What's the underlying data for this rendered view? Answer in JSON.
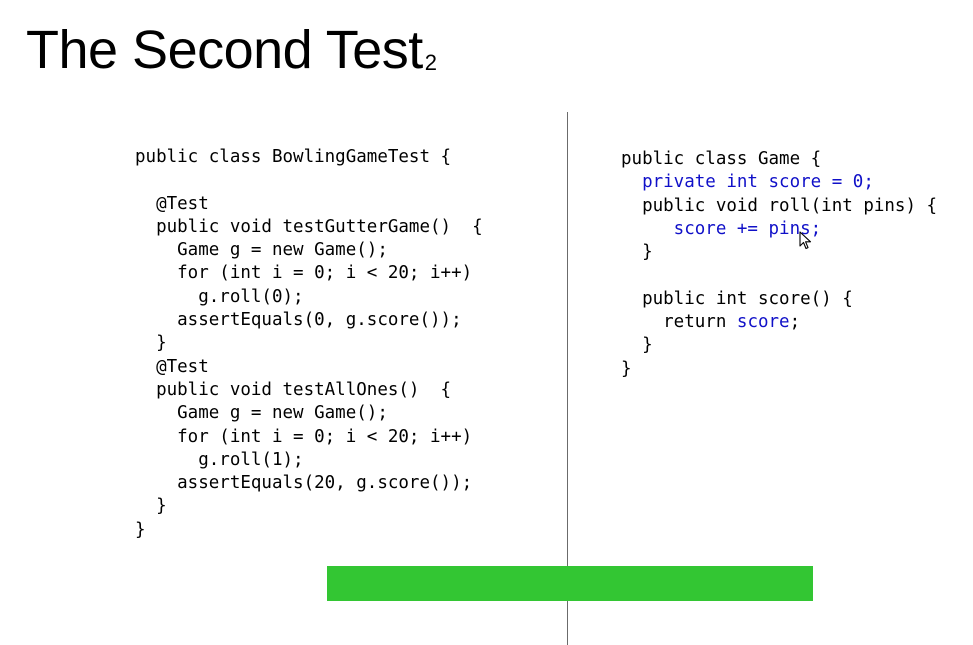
{
  "slide": {
    "title": "The Second Test",
    "title_subscript": "2"
  },
  "test_code": [
    "public class BowlingGameTest {",
    "",
    "  @Test",
    "  public void testGutterGame()  {",
    "    Game g = new Game();",
    "    for (int i = 0; i < 20; i++)",
    "      g.roll(0);",
    "    assertEquals(0, g.score());",
    "  }",
    "  @Test",
    "  public void testAllOnes()  {",
    "    Game g = new Game();",
    "    for (int i = 0; i < 20; i++)",
    "      g.roll(1);",
    "    assertEquals(20, g.score());",
    "  }",
    "}"
  ],
  "game_code": {
    "l1": "public class Game {",
    "l2": "  private int score = 0;",
    "l3": "  public void roll(int pins) {",
    "l4": "     score += pins;",
    "l5": "  }",
    "l6": "",
    "l7": "  public int score() {",
    "l8a": "    return ",
    "l8b": "score",
    "l8c": ";",
    "l9": "  }",
    "l10": "}"
  },
  "colors": {
    "highlight": "#1010c8",
    "test_bar": "#33c633",
    "divider": "#6b6b6b"
  },
  "test_status": "pass",
  "icons": {
    "pointer": "mouse-pointer-icon"
  }
}
